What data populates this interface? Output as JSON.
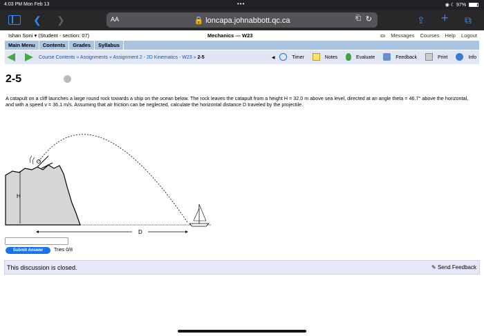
{
  "status": {
    "time": "4:03 PM  Mon Feb 13",
    "dots": "•••",
    "battery": "97%"
  },
  "browser": {
    "aa": "AA",
    "url": "loncapa.johnabbott.qc.ca"
  },
  "top": {
    "user": "Ishan Soni ▾ (Student  - section: 07)",
    "title": "Mechanics --- W23",
    "links": [
      "Messages",
      "Courses",
      "Help",
      "Logout"
    ]
  },
  "nav": [
    "Main Menu",
    "Contents",
    "Grades",
    "Syllabus"
  ],
  "crumbs": {
    "trail": "Course Contents » Assignments » Assignment 2 - 2D Kinematics - W23 » ",
    "current": "2-5"
  },
  "tools": [
    "Timer",
    "Notes",
    "Evaluate",
    "Feedback",
    "Print",
    "Info"
  ],
  "problem": {
    "id": "2-5",
    "text": "A catapult on a cliff launches a large round rock towards a ship on the ocean below. The rock leaves the catapult from a height H = 32.0 m above sea level, directed at an angle theta = 46.7° above the horizontal, and with a speed v = 36.1 m/s. Assuming that air friction can be neglected, calculate the horizontal distance D traveled by the projectile.",
    "labels": {
      "h": "H",
      "d": "D"
    }
  },
  "answer": {
    "submit": "Submit Answer",
    "tries": "Tries 0/8"
  },
  "discussion": {
    "closed": "This discussion is closed.",
    "feedback": "Send Feedback"
  },
  "colors": {
    "nav": "#a9c3e2",
    "crumbbar": "#e0e6f3",
    "closed": "#e6e8fa",
    "submit": "#1a73e8"
  }
}
